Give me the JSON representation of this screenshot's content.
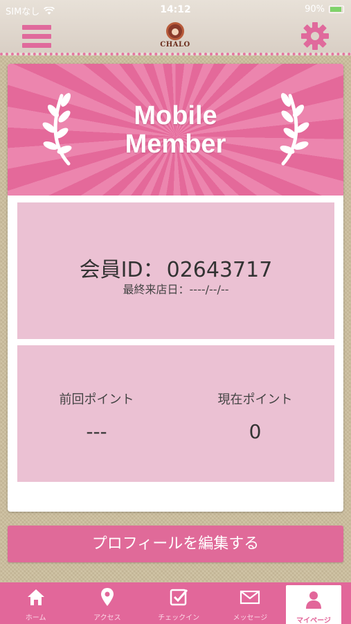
{
  "status_bar": {
    "carrier": "SIMなし",
    "time": "14:12",
    "battery": "90%"
  },
  "header": {
    "logo_text": "CHALO"
  },
  "banner": {
    "title_line1": "Mobile",
    "title_line2": "Member"
  },
  "member": {
    "id_label": "会員ID：",
    "id_value": "02643717",
    "last_visit_label": "最終来店日：",
    "last_visit_value": "----/--/--"
  },
  "points": {
    "previous_label": "前回ポイント",
    "previous_value": "---",
    "current_label": "現在ポイント",
    "current_value": "0"
  },
  "edit_button_label": "プロフィールを編集する",
  "tabs": [
    {
      "label": "ホーム",
      "icon": "home-icon"
    },
    {
      "label": "アクセス",
      "icon": "map-pin-icon"
    },
    {
      "label": "チェックイン",
      "icon": "checkin-icon"
    },
    {
      "label": "メッセージ",
      "icon": "mail-icon"
    },
    {
      "label": "マイページ",
      "icon": "person-icon"
    }
  ],
  "colors": {
    "accent": "#e2679a",
    "panel": "#ebc1d3",
    "background": "#cdbf9e"
  }
}
